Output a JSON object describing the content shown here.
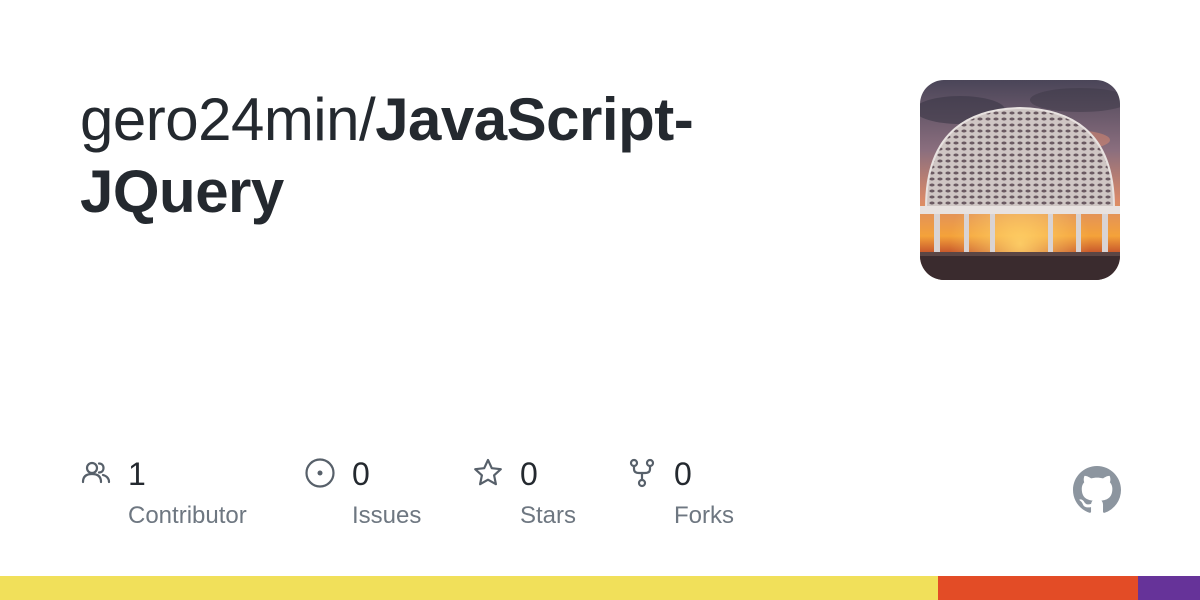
{
  "repo": {
    "owner": "gero24min/",
    "name": "JavaScript-JQuery"
  },
  "avatar": {
    "description_icon": "dome-sunset-photo"
  },
  "stats": [
    {
      "icon": "people-icon",
      "count": "1",
      "label": "Contributor"
    },
    {
      "icon": "issue-icon",
      "count": "0",
      "label": "Issues"
    },
    {
      "icon": "star-icon",
      "count": "0",
      "label": "Stars"
    },
    {
      "icon": "fork-icon",
      "count": "0",
      "label": "Forks"
    }
  ],
  "brand_icon": "github-icon",
  "language_bar": [
    {
      "color": "#f1e05a",
      "fraction": 0.782
    },
    {
      "color": "#e34c26",
      "fraction": 0.166
    },
    {
      "color": "#663399",
      "fraction": 0.052
    }
  ],
  "colors": {
    "text_primary": "#24292f",
    "text_secondary": "#6e7781",
    "icon": "#57606a"
  }
}
